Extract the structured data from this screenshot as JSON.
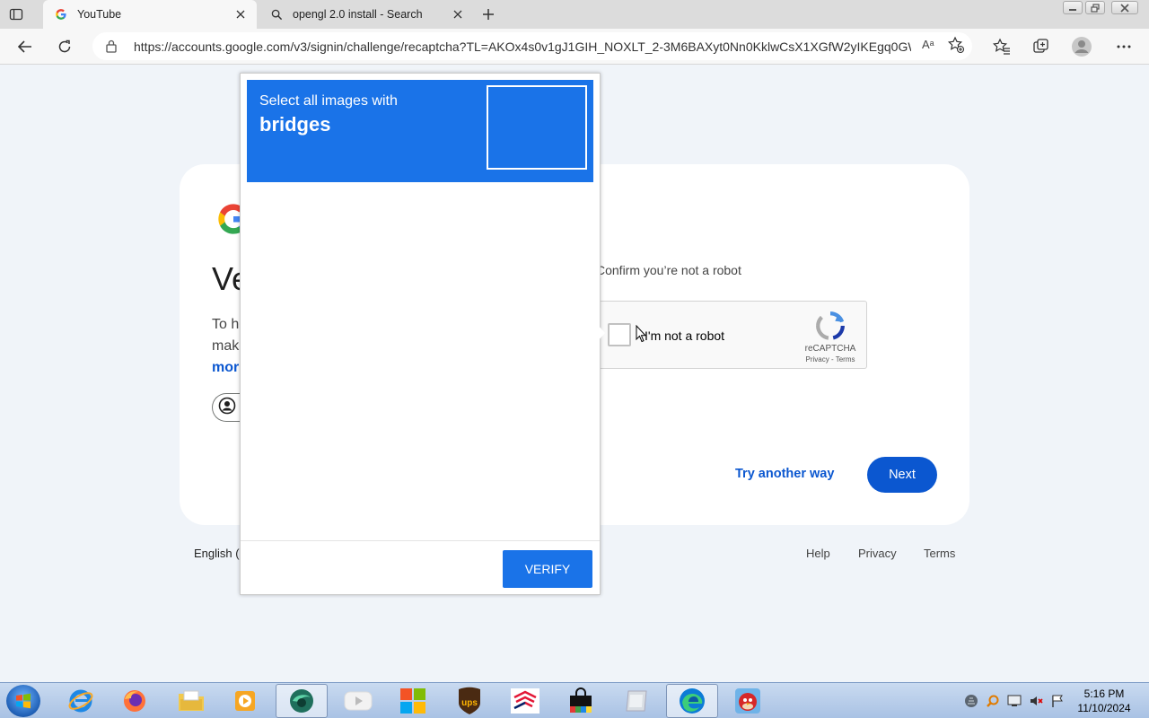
{
  "browser": {
    "tabs": [
      {
        "title": "YouTube",
        "icon": "google-g-icon",
        "active": true
      },
      {
        "title": "opengl 2.0 install - Search",
        "icon": "search-icon",
        "active": false
      }
    ],
    "url": "https://accounts.google.com/v3/signin/challenge/recaptcha?TL=AKOx4s0v1gJ1GIH_NOXLT_2-3M6BAXyt0Nn0KklwCsX1XGfW2yIKEgq0GW...",
    "read_aloud_label": "Aᵃ"
  },
  "page": {
    "heading": "Ve",
    "desc_lines": [
      "To he",
      "make",
      "mor"
    ],
    "confirm_text": "Confirm you’re not a robot",
    "recaptcha": {
      "checkbox_label": "I'm not a robot",
      "brand": "reCAPTCHA",
      "links": "Privacy - Terms"
    },
    "try_another": "Try another way",
    "next": "Next",
    "language": "English (U",
    "footer_links": [
      "Help",
      "Privacy",
      "Terms"
    ]
  },
  "challenge": {
    "prompt_line1": "Select all images with",
    "prompt_target": "bridges",
    "verify_label": "VERIFY"
  },
  "taskbar": {
    "apps": [
      "internet-explorer",
      "firefox",
      "file-explorer",
      "media-player",
      "green-app",
      "youtube",
      "microsoft-store",
      "ups",
      "bank-of-america",
      "shopping-bag",
      "vm-app",
      "edge",
      "angry-birds"
    ],
    "time": "5:16 PM",
    "date": "11/10/2024"
  },
  "colors": {
    "accent_blue": "#0b57d0",
    "recaptcha_blue": "#1a73e8",
    "page_bg": "#f0f4f9"
  }
}
